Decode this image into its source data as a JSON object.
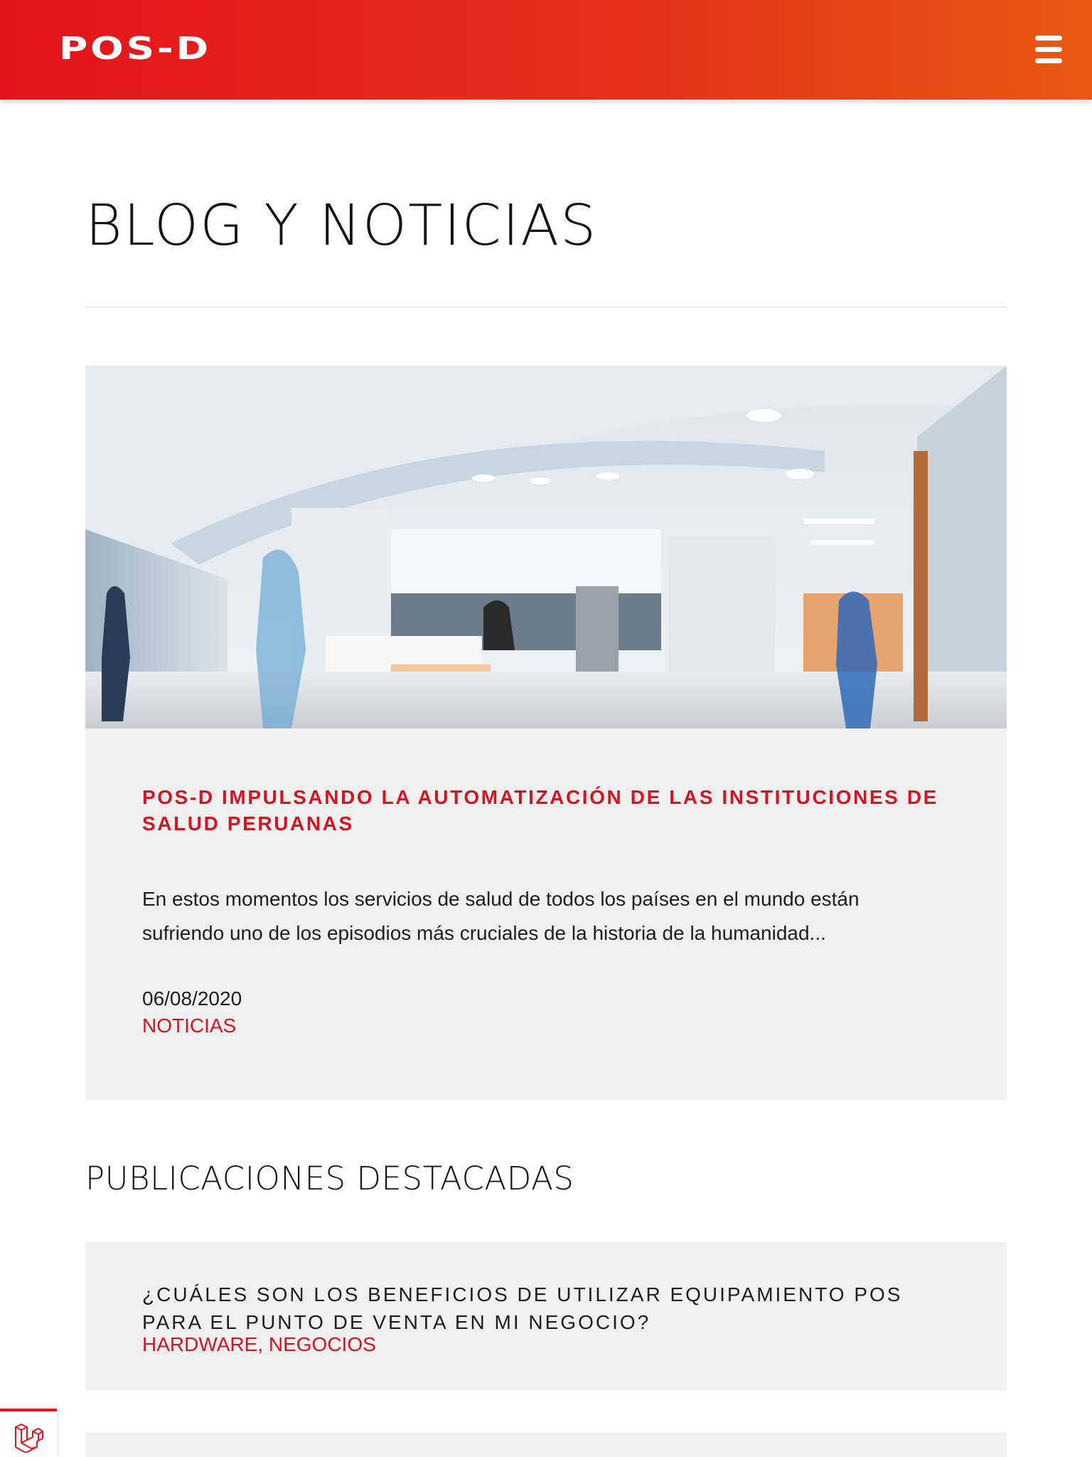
{
  "header": {
    "logo_text": "POS-D",
    "menu_icon": "hamburger-menu-icon",
    "gradient_from": "#e3141d",
    "gradient_to": "#e85a12"
  },
  "page": {
    "title": "BLOG Y NOTICIAS"
  },
  "featured_post": {
    "image_description_icon": "hospital-photo",
    "title": "POS-D IMPULSANDO LA AUTOMATIZACIÓN DE LAS INSTITUCIONES DE SALUD PERUANAS",
    "excerpt": "En estos momentos los servicios de salud de todos los países en el mundo están sufriendo uno de los episodios más cruciales de la historia de la humanidad...",
    "date": "06/08/2020",
    "category": "NOTICIAS"
  },
  "featured_section": {
    "title": "PUBLICACIONES DESTACADAS",
    "items": [
      {
        "title": "¿CUÁLES SON LOS BENEFICIOS DE UTILIZAR EQUIPAMIENTO POS PARA EL PUNTO DE VENTA EN MI NEGOCIO?",
        "tags": "HARDWARE, NEGOCIOS"
      }
    ]
  },
  "floating_badge": {
    "icon": "laravel-icon"
  },
  "colors": {
    "accent": "#d51420",
    "card_background": "#f0f0f0"
  }
}
